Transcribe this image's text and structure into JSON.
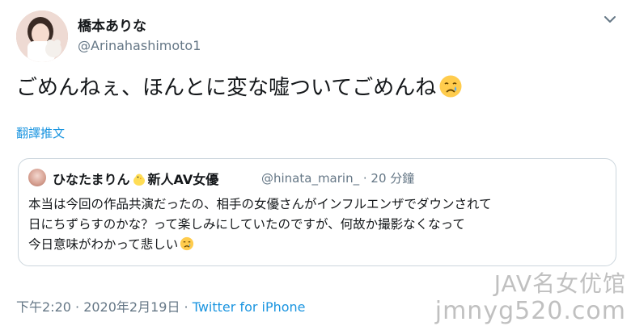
{
  "tweet": {
    "author": {
      "display_name": "橋本ありな",
      "handle": "@Arinahashimoto1",
      "avatar": "avatar-photo"
    },
    "more_icon": "chevron-down-icon",
    "text": "ごめんねぇ、ほんとに変な嘘ついてごめんね",
    "text_emoji": "crying-face-emoji",
    "translate_label": "翻譯推文",
    "timestamp": "下午2:20 · 2020年2月19日 · ",
    "source": "Twitter for iPhone"
  },
  "quoted_tweet": {
    "display_name_part1": "ひなたまりん",
    "display_name_emoji": "chick-emoji",
    "display_name_part2": "新人AV女優",
    "handle_and_time": "@hinata_marin_ · 20 分鐘",
    "lines": [
      "本当は今回の作品共演だったの、相手の女優さんがインフルエンザでダウンされて",
      "日にちずらすのかな？って楽しみにしていたのですが、何故か撮影なくなって",
      "今日意味がわかって悲しい"
    ],
    "line_emoji": "crying-face-emoji"
  },
  "watermark": {
    "line1": "JAV名女优馆",
    "line2": "jmnyg520.com"
  }
}
